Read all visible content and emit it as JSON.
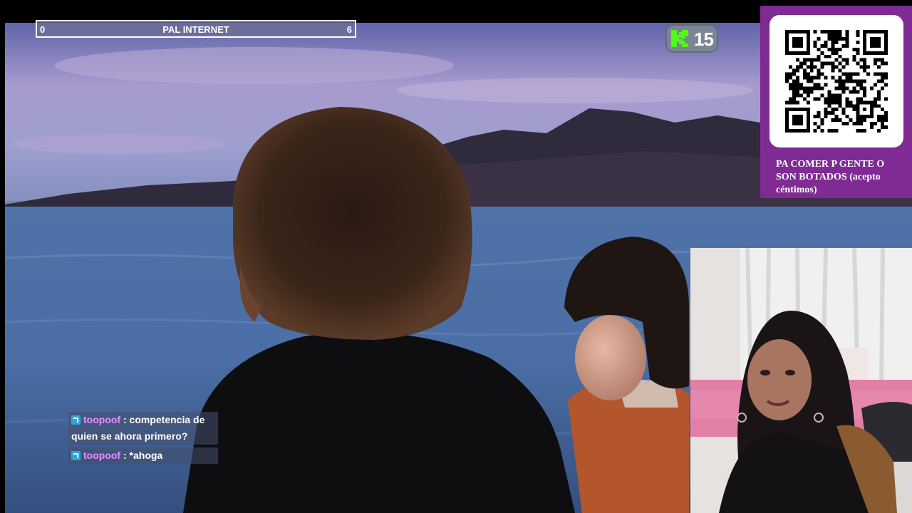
{
  "progress": {
    "min_label": "0",
    "max_label": "6",
    "title": "PAL INTERNET",
    "current": 0,
    "max": 6
  },
  "kick": {
    "count": "15",
    "icon": "kick-logo",
    "brand_color": "#53fc18"
  },
  "qr_panel": {
    "caption": "PA COMER P GENTE O SON BOTADOS (acepto céntimos)",
    "background": "#7f2b93",
    "icon": "qr-code"
  },
  "chat": {
    "messages": [
      {
        "user": "toopoof",
        "separator": ":",
        "text": "competencia de quien se ahora primero?"
      },
      {
        "user": "toopoof",
        "separator": ":",
        "text": "*ahoga"
      }
    ],
    "user_color": "#e68cff",
    "badge_color": "#2da4d8"
  }
}
